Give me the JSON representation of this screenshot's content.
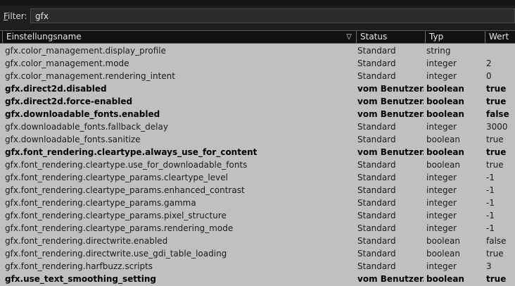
{
  "filter": {
    "label_prefix": "F",
    "label_rest": "ilter:",
    "value": "gfx"
  },
  "columns": [
    "Einstellungsname",
    "Status",
    "Typ",
    "Wert"
  ],
  "rows": [
    {
      "name": "gfx.color_management.display_profile",
      "status": "Standard",
      "type": "string",
      "value": "",
      "modified": false
    },
    {
      "name": "gfx.color_management.mode",
      "status": "Standard",
      "type": "integer",
      "value": "2",
      "modified": false
    },
    {
      "name": "gfx.color_management.rendering_intent",
      "status": "Standard",
      "type": "integer",
      "value": "0",
      "modified": false
    },
    {
      "name": "gfx.direct2d.disabled",
      "status": "vom Benutzer...",
      "type": "boolean",
      "value": "true",
      "modified": true
    },
    {
      "name": "gfx.direct2d.force-enabled",
      "status": "vom Benutzer...",
      "type": "boolean",
      "value": "true",
      "modified": true
    },
    {
      "name": "gfx.downloadable_fonts.enabled",
      "status": "vom Benutzer...",
      "type": "boolean",
      "value": "false",
      "modified": true
    },
    {
      "name": "gfx.downloadable_fonts.fallback_delay",
      "status": "Standard",
      "type": "integer",
      "value": "3000",
      "modified": false
    },
    {
      "name": "gfx.downloadable_fonts.sanitize",
      "status": "Standard",
      "type": "boolean",
      "value": "true",
      "modified": false
    },
    {
      "name": "gfx.font_rendering.cleartype.always_use_for_content",
      "status": "vom Benutzer...",
      "type": "boolean",
      "value": "true",
      "modified": true
    },
    {
      "name": "gfx.font_rendering.cleartype.use_for_downloadable_fonts",
      "status": "Standard",
      "type": "boolean",
      "value": "true",
      "modified": false
    },
    {
      "name": "gfx.font_rendering.cleartype_params.cleartype_level",
      "status": "Standard",
      "type": "integer",
      "value": "-1",
      "modified": false
    },
    {
      "name": "gfx.font_rendering.cleartype_params.enhanced_contrast",
      "status": "Standard",
      "type": "integer",
      "value": "-1",
      "modified": false
    },
    {
      "name": "gfx.font_rendering.cleartype_params.gamma",
      "status": "Standard",
      "type": "integer",
      "value": "-1",
      "modified": false
    },
    {
      "name": "gfx.font_rendering.cleartype_params.pixel_structure",
      "status": "Standard",
      "type": "integer",
      "value": "-1",
      "modified": false
    },
    {
      "name": "gfx.font_rendering.cleartype_params.rendering_mode",
      "status": "Standard",
      "type": "integer",
      "value": "-1",
      "modified": false
    },
    {
      "name": "gfx.font_rendering.directwrite.enabled",
      "status": "Standard",
      "type": "boolean",
      "value": "false",
      "modified": false
    },
    {
      "name": "gfx.font_rendering.directwrite.use_gdi_table_loading",
      "status": "Standard",
      "type": "boolean",
      "value": "true",
      "modified": false
    },
    {
      "name": "gfx.font_rendering.harfbuzz.scripts",
      "status": "Standard",
      "type": "integer",
      "value": "3",
      "modified": false
    },
    {
      "name": "gfx.use_text_smoothing_setting",
      "status": "vom Benutzer...",
      "type": "boolean",
      "value": "true",
      "modified": true
    }
  ]
}
